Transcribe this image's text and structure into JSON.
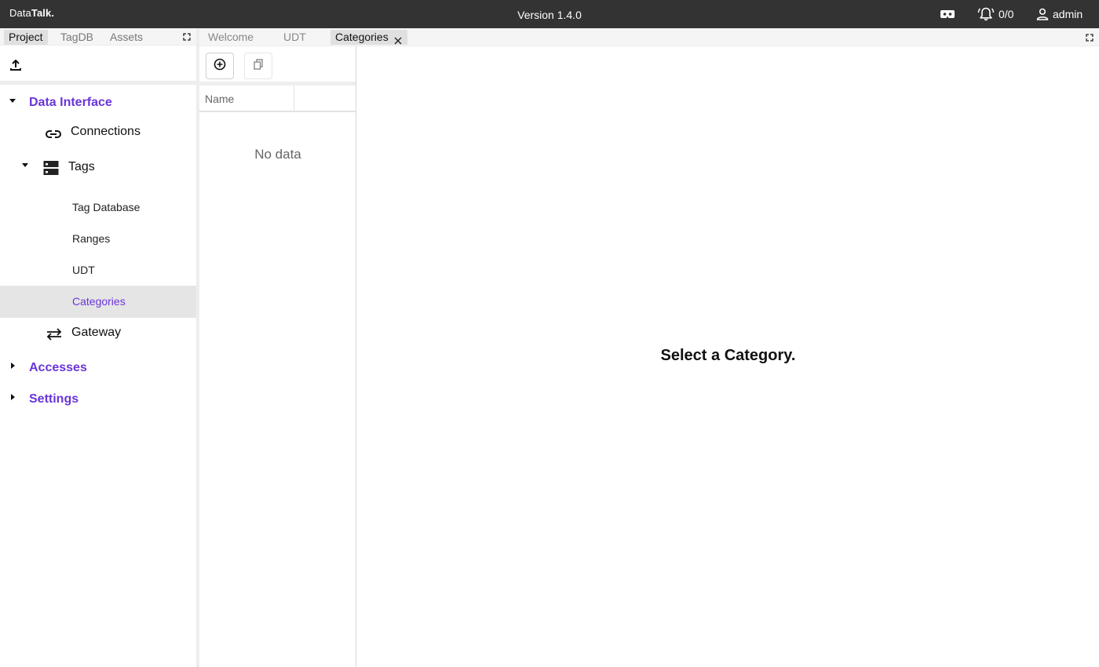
{
  "app": {
    "brand_light": "Data",
    "brand_bold": "Talk.",
    "version": "Version 1.4.0",
    "alarm_count": "0/0",
    "user": "admin"
  },
  "left_tabs": [
    "Project",
    "TagDB",
    "Assets"
  ],
  "tree": {
    "data_interface": "Data Interface",
    "connections": "Connections",
    "tags": "Tags",
    "tag_database": "Tag Database",
    "ranges": "Ranges",
    "udt": "UDT",
    "categories": "Categories",
    "gateway": "Gateway",
    "accesses": "Accesses",
    "settings": "Settings"
  },
  "right_tabs": [
    "Welcome",
    "UDT",
    "Categories"
  ],
  "list": {
    "column_name": "Name",
    "empty_text": "No data"
  },
  "main": {
    "placeholder": "Select a Category."
  },
  "colors": {
    "topbar": "#333333",
    "accent": "#6a35d9",
    "selected_row": "#e5e5e5"
  },
  "icons": [
    "vr-headset-icon",
    "alarm-bell-icon",
    "user-icon",
    "upload-icon",
    "link-icon",
    "storage-icon",
    "swap-icon",
    "add-circle-icon",
    "copy-icon",
    "close-icon",
    "fullscreen-icon"
  ]
}
